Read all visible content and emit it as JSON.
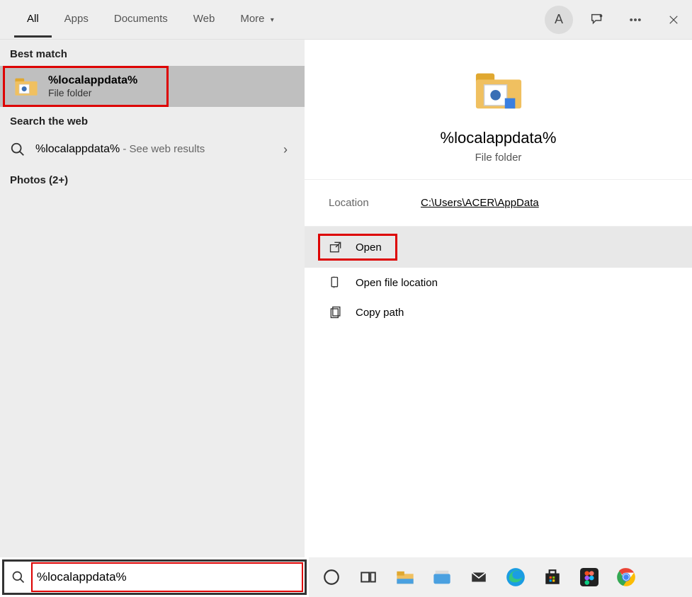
{
  "header": {
    "tabs": [
      "All",
      "Apps",
      "Documents",
      "Web",
      "More"
    ],
    "avatar_initial": "A"
  },
  "left": {
    "best_match_header": "Best match",
    "best_match": {
      "title": "%localappdata%",
      "subtitle": "File folder"
    },
    "search_web_header": "Search the web",
    "web_result": {
      "term": "%localappdata%",
      "suffix": " - See web results"
    },
    "photos_header": "Photos (2+)"
  },
  "preview": {
    "title": "%localappdata%",
    "subtitle": "File folder",
    "location_label": "Location",
    "location_value": "C:\\Users\\ACER\\AppData",
    "actions": {
      "open": "Open",
      "open_file_location": "Open file location",
      "copy_path": "Copy path"
    }
  },
  "search": {
    "value": "%localappdata%"
  },
  "icons": {
    "more_chevron": "▾",
    "chevron_right": "›"
  }
}
